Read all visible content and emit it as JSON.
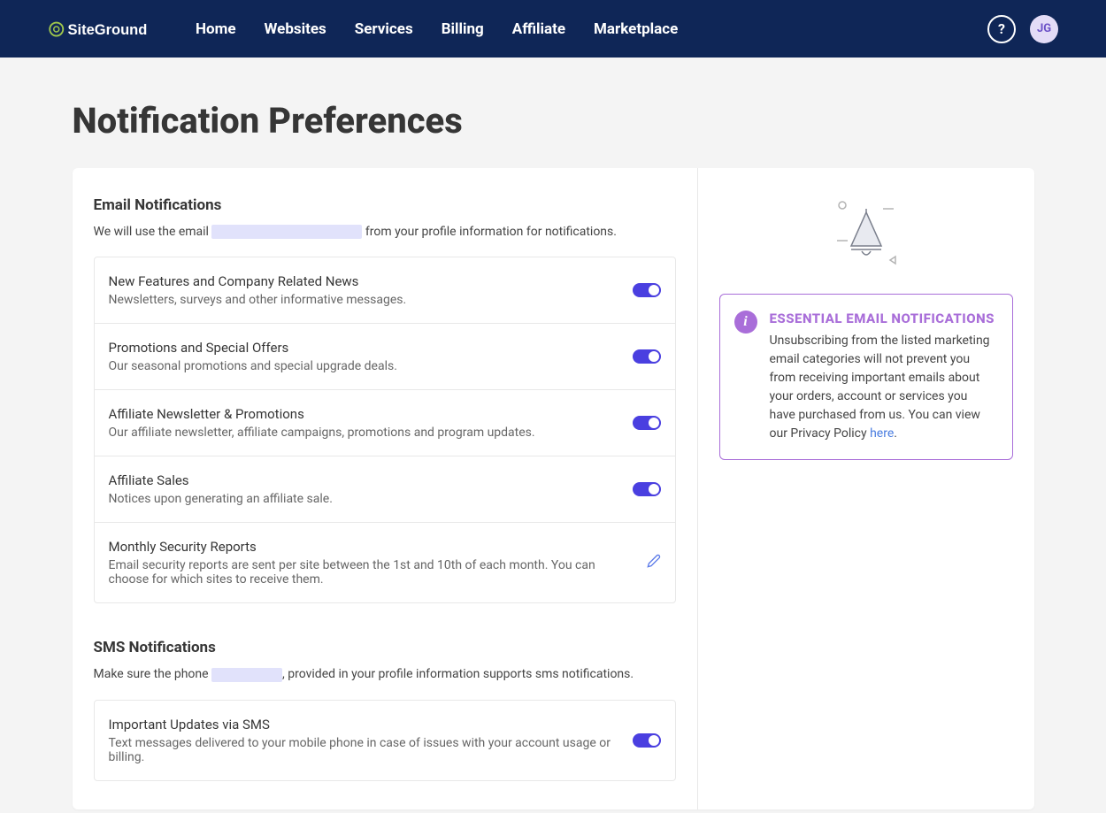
{
  "brand": "SiteGround",
  "nav": {
    "items": [
      "Home",
      "Websites",
      "Services",
      "Billing",
      "Affiliate",
      "Marketplace"
    ]
  },
  "user": {
    "initials": "JG"
  },
  "page": {
    "title": "Notification Preferences"
  },
  "email_section": {
    "title": "Email Notifications",
    "desc_prefix": "We will use the email ",
    "desc_suffix": " from your profile information for notifications.",
    "items": [
      {
        "title": "New Features and Company Related News",
        "desc": "Newsletters, surveys and other informative messages.",
        "enabled": true
      },
      {
        "title": "Promotions and Special Offers",
        "desc": "Our seasonal promotions and special upgrade deals.",
        "enabled": true
      },
      {
        "title": "Affiliate Newsletter & Promotions",
        "desc": "Our affiliate newsletter, affiliate campaigns, promotions and program updates.",
        "enabled": true
      },
      {
        "title": "Affiliate Sales",
        "desc": "Notices upon generating an affiliate sale.",
        "enabled": true
      },
      {
        "title": "Monthly Security Reports",
        "desc": "Email security reports are sent per site between the 1st and 10th of each month. You can choose for which sites to receive them.",
        "editable": true
      }
    ]
  },
  "sms_section": {
    "title": "SMS Notifications",
    "desc_prefix": "Make sure the phone ",
    "desc_suffix": ", provided in your profile information supports sms notifications.",
    "items": [
      {
        "title": "Important Updates via SMS",
        "desc": "Text messages delivered to your mobile phone in case of issues with your account usage or billing.",
        "enabled": true
      }
    ]
  },
  "info_box": {
    "title": "ESSENTIAL EMAIL NOTIFICATIONS",
    "text": "Unsubscribing from the listed marketing email categories will not prevent you from receiving important emails about your orders, account or services you have purchased from us. You can view our Privacy Policy ",
    "link_text": "here",
    "suffix": "."
  }
}
